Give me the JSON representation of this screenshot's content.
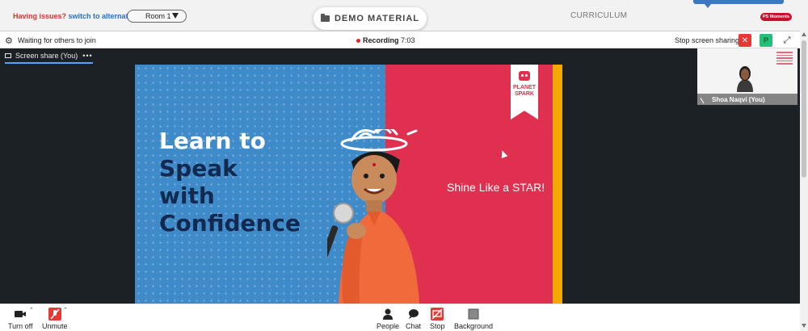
{
  "topbar": {
    "issues_text": "Having issues?",
    "switch_link": "switch to alternate room",
    "room_select": "Room 1",
    "demo_material": "DEMO MATERIAL",
    "curriculum": "CURRICULUM",
    "moments_badge": "PS Moments"
  },
  "meeting": {
    "waiting_text": "Waiting for others to join",
    "recording_label": "Recording",
    "recording_time": "7:03",
    "stop_sharing": "Stop screen sharing",
    "close_label": "✕",
    "p_label": "P",
    "expand_label": "⤢"
  },
  "stage": {
    "share_label": "Screen share (You)",
    "share_menu": "•••"
  },
  "slide": {
    "headline_lines": [
      "Learn to",
      "Speak",
      "with",
      "Confidence"
    ],
    "tagline": "Shine Like a STAR!",
    "brand_line1": "PLANET",
    "brand_line2": "SPARK",
    "colors": {
      "blue": "#3f8bc9",
      "pink": "#e0304f",
      "yellow": "#f2a900",
      "navy": "#14294f"
    }
  },
  "selfview": {
    "name": "Shoa Naqvi (You)"
  },
  "toolbar": {
    "turn_off": "Turn off",
    "unmute": "Unmute",
    "people": "People",
    "chat": "Chat",
    "stop": "Stop",
    "background": "Background"
  }
}
